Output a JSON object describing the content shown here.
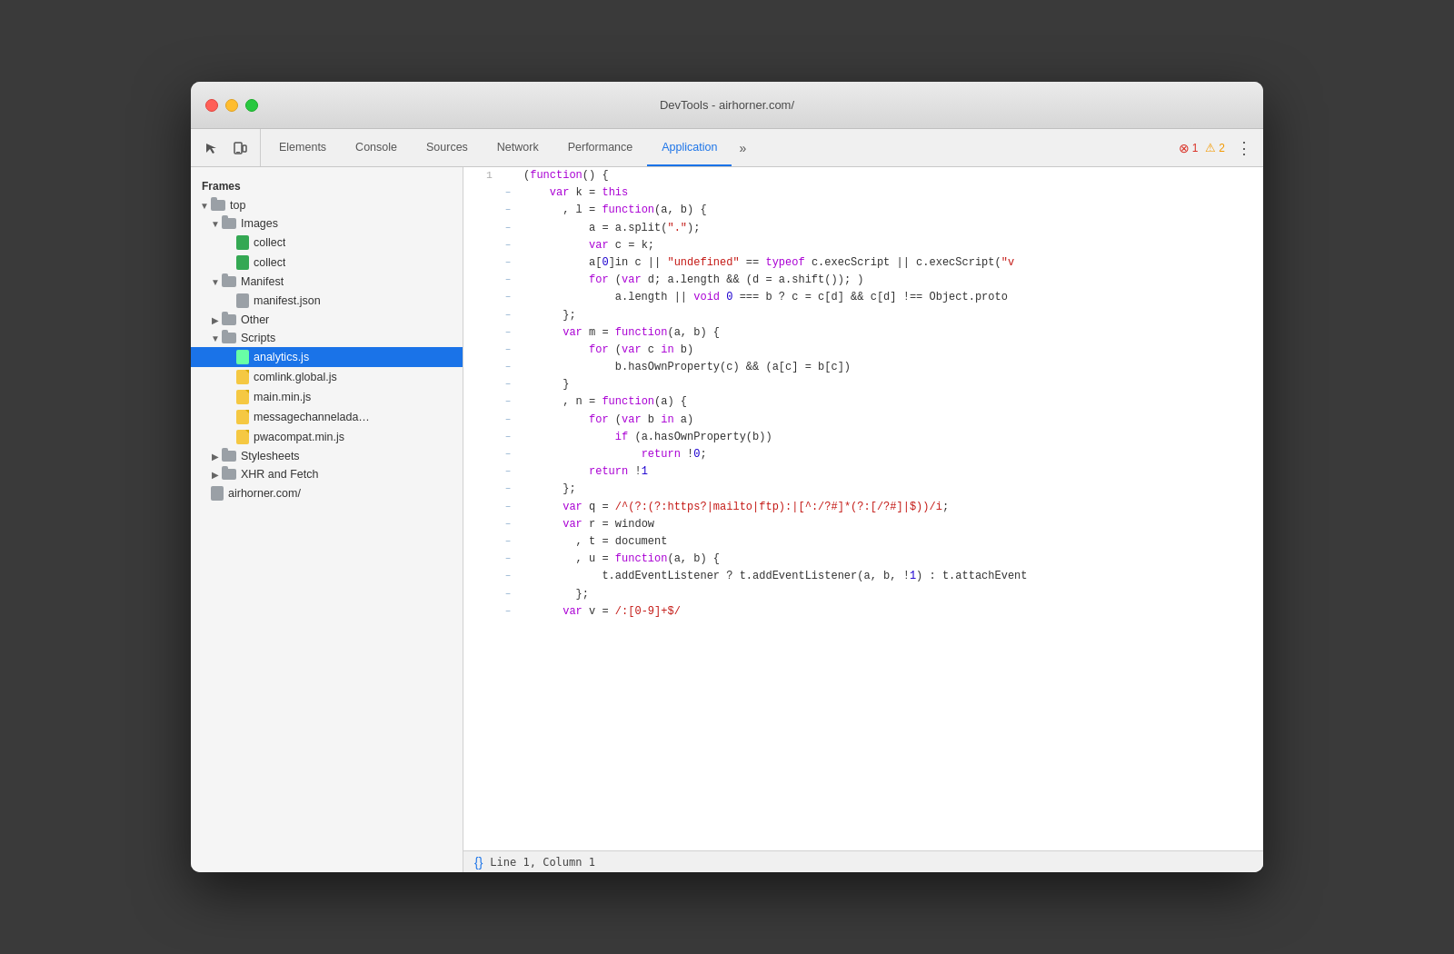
{
  "window": {
    "title": "DevTools - airhorner.com/"
  },
  "tabs": [
    {
      "id": "elements",
      "label": "Elements",
      "active": false
    },
    {
      "id": "console",
      "label": "Console",
      "active": false
    },
    {
      "id": "sources",
      "label": "Sources",
      "active": false
    },
    {
      "id": "network",
      "label": "Network",
      "active": false
    },
    {
      "id": "performance",
      "label": "Performance",
      "active": false
    },
    {
      "id": "application",
      "label": "Application",
      "active": true
    }
  ],
  "error_count": "1",
  "warn_count": "2",
  "sidebar": {
    "section_label": "Frames",
    "tree": [
      {
        "id": "top",
        "label": "top",
        "level": 0,
        "type": "folder-open",
        "icon": "folder"
      },
      {
        "id": "images",
        "label": "Images",
        "level": 1,
        "type": "folder-open",
        "icon": "folder"
      },
      {
        "id": "collect1",
        "label": "collect",
        "level": 2,
        "type": "file",
        "icon": "green"
      },
      {
        "id": "collect2",
        "label": "collect",
        "level": 2,
        "type": "file",
        "icon": "green"
      },
      {
        "id": "manifest",
        "label": "Manifest",
        "level": 1,
        "type": "folder-open",
        "icon": "folder"
      },
      {
        "id": "manifest_json",
        "label": "manifest.json",
        "level": 2,
        "type": "file",
        "icon": "grey"
      },
      {
        "id": "other",
        "label": "Other",
        "level": 1,
        "type": "folder-closed",
        "icon": "folder"
      },
      {
        "id": "scripts",
        "label": "Scripts",
        "level": 1,
        "type": "folder-open",
        "icon": "folder"
      },
      {
        "id": "analytics",
        "label": "analytics.js",
        "level": 2,
        "type": "file",
        "icon": "green",
        "selected": true
      },
      {
        "id": "comlink",
        "label": "comlink.global.js",
        "level": 2,
        "type": "file",
        "icon": "yellow"
      },
      {
        "id": "main_min",
        "label": "main.min.js",
        "level": 2,
        "type": "file",
        "icon": "yellow"
      },
      {
        "id": "messagechannel",
        "label": "messagechannelada…",
        "level": 2,
        "type": "file",
        "icon": "yellow"
      },
      {
        "id": "pwacompat",
        "label": "pwacompat.min.js",
        "level": 2,
        "type": "file",
        "icon": "yellow"
      },
      {
        "id": "stylesheets",
        "label": "Stylesheets",
        "level": 1,
        "type": "folder-closed",
        "icon": "folder"
      },
      {
        "id": "xhr",
        "label": "XHR and Fetch",
        "level": 1,
        "type": "folder-closed",
        "icon": "folder"
      },
      {
        "id": "airhorner",
        "label": "airhorner.com/",
        "level": 0,
        "type": "file",
        "icon": "grey"
      }
    ]
  },
  "code": {
    "lines": [
      {
        "num": "1",
        "gutter": "",
        "content": "(function() {"
      },
      {
        "num": "",
        "gutter": "–",
        "content": "    var k = this"
      },
      {
        "num": "",
        "gutter": "–",
        "content": "      , l = function(a, b) {"
      },
      {
        "num": "",
        "gutter": "–",
        "content": "          a = a.split(\".\");"
      },
      {
        "num": "",
        "gutter": "–",
        "content": "          var c = k;"
      },
      {
        "num": "",
        "gutter": "–",
        "content": "          a[0]in c || \"undefined\" == typeof c.execScript || c.execScript(\"v"
      },
      {
        "num": "",
        "gutter": "–",
        "content": "          for (var d; a.length && (d = a.shift()); )"
      },
      {
        "num": "",
        "gutter": "–",
        "content": "              a.length || void 0 === b ? c = c[d] && c[d] !== Object.proto"
      },
      {
        "num": "",
        "gutter": "–",
        "content": "      };"
      },
      {
        "num": "",
        "gutter": "–",
        "content": "      var m = function(a, b) {"
      },
      {
        "num": "",
        "gutter": "–",
        "content": "          for (var c in b)"
      },
      {
        "num": "",
        "gutter": "–",
        "content": "              b.hasOwnProperty(c) && (a[c] = b[c])"
      },
      {
        "num": "",
        "gutter": "–",
        "content": "      }"
      },
      {
        "num": "",
        "gutter": "–",
        "content": "      , n = function(a) {"
      },
      {
        "num": "",
        "gutter": "–",
        "content": "          for (var b in a)"
      },
      {
        "num": "",
        "gutter": "–",
        "content": "              if (a.hasOwnProperty(b))"
      },
      {
        "num": "",
        "gutter": "–",
        "content": "                  return !0;"
      },
      {
        "num": "",
        "gutter": "–",
        "content": "          return !1"
      },
      {
        "num": "",
        "gutter": "–",
        "content": "      };"
      },
      {
        "num": "",
        "gutter": "–",
        "content": "      var q = /^(?:(?:https?|mailto|ftp):|[^:/?#]*(?:[/?#]|$))/i;"
      },
      {
        "num": "",
        "gutter": "–",
        "content": "      var r = window"
      },
      {
        "num": "",
        "gutter": "–",
        "content": "        , t = document"
      },
      {
        "num": "",
        "gutter": "–",
        "content": "        , u = function(a, b) {"
      },
      {
        "num": "",
        "gutter": "–",
        "content": "            t.addEventListener ? t.addEventListener(a, b, !1) : t.attachEvent"
      },
      {
        "num": "",
        "gutter": "–",
        "content": "        };"
      },
      {
        "num": "",
        "gutter": "–",
        "content": "      var v = /:[0-9]+$/"
      }
    ],
    "status": "Line 1, Column 1"
  }
}
